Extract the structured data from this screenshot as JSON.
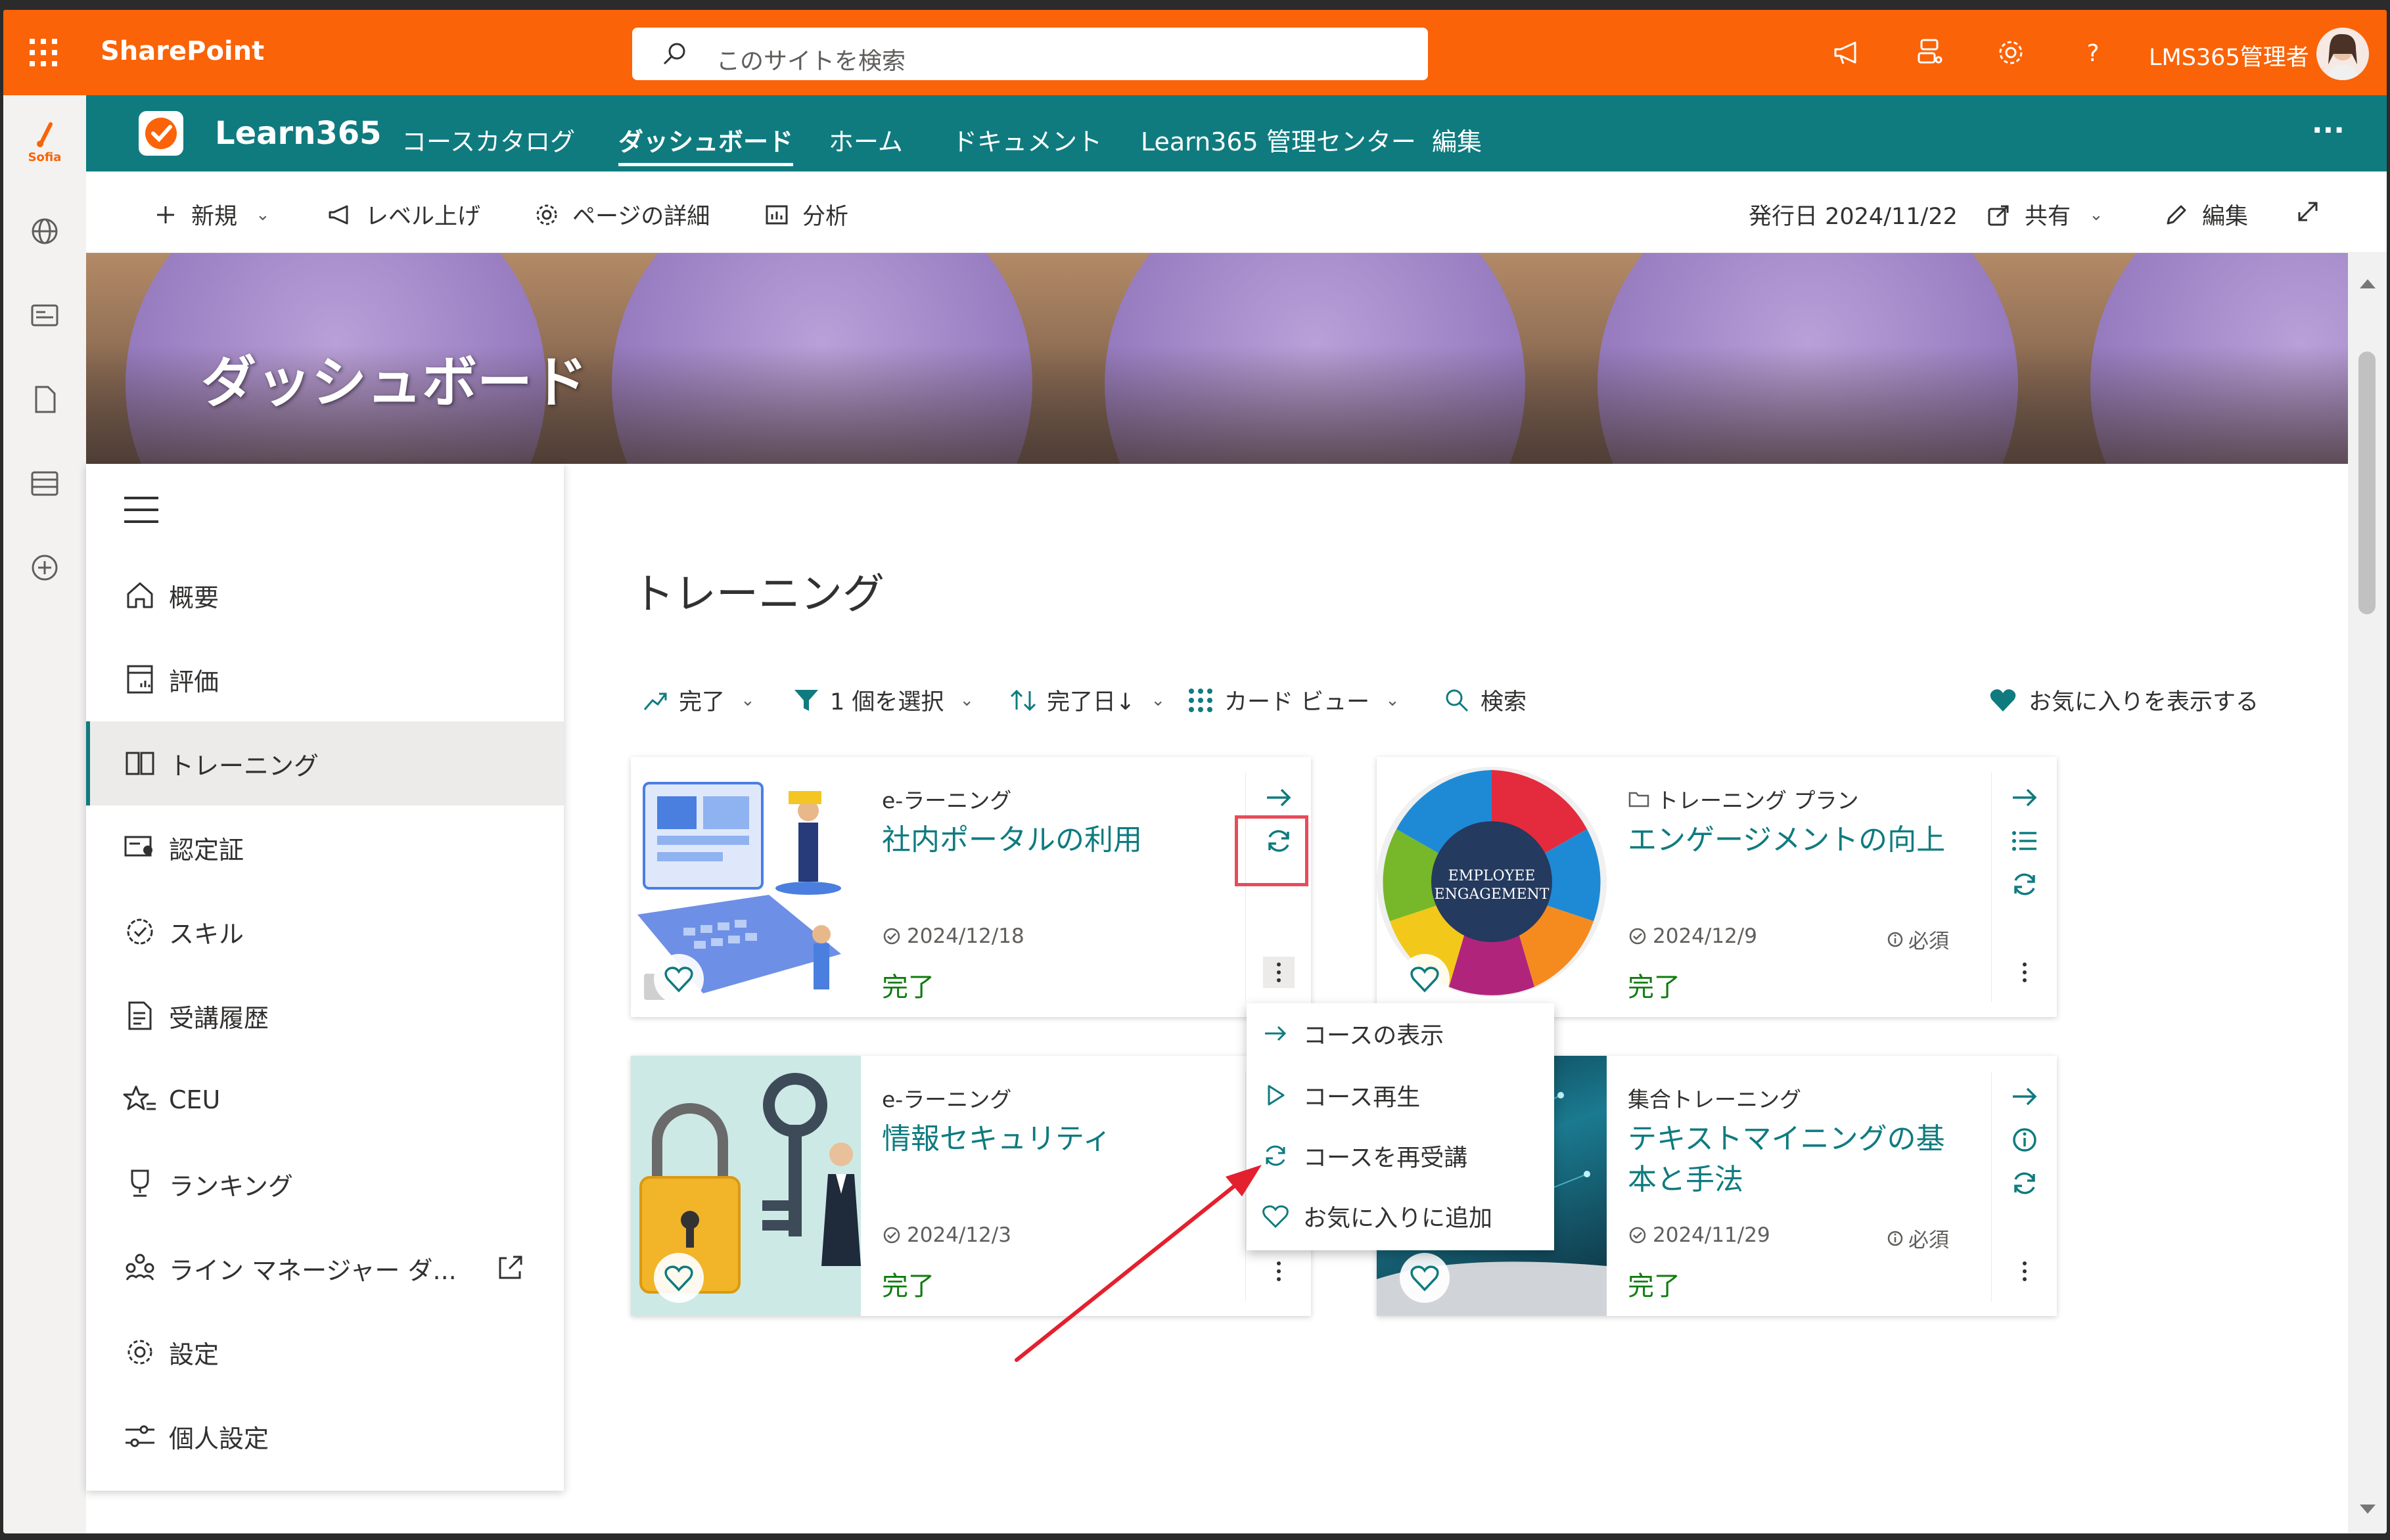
{
  "suite": {
    "brand": "SharePoint",
    "search_placeholder": "このサイトを検索",
    "user_name": "LMS365管理者"
  },
  "rail": {
    "logo_text": "Sofia"
  },
  "hub": {
    "title": "Learn365",
    "links": [
      "コースカタログ",
      "ダッシュボード",
      "ホーム",
      "ドキュメント",
      "Learn365 管理センター",
      "編集"
    ],
    "active_link": "ダッシュボード"
  },
  "command": {
    "new": "新規",
    "promote": "レベル上げ",
    "page_details": "ページの詳細",
    "analytics": "分析",
    "published": "発行日 2024/11/22",
    "share": "共有",
    "edit": "編集"
  },
  "hero": {
    "title": "ダッシュボード"
  },
  "nav": {
    "items": [
      {
        "label": "概要",
        "icon": "home-icon"
      },
      {
        "label": "評価",
        "icon": "assessment-icon"
      },
      {
        "label": "トレーニング",
        "icon": "book-icon"
      },
      {
        "label": "認定証",
        "icon": "certificate-icon"
      },
      {
        "label": "スキル",
        "icon": "skill-badge-icon"
      },
      {
        "label": "受講履歴",
        "icon": "history-doc-icon"
      },
      {
        "label": "CEU",
        "icon": "star-list-icon"
      },
      {
        "label": "ランキング",
        "icon": "trophy-icon"
      },
      {
        "label": "ライン マネージャー ダ...",
        "icon": "people-icon"
      },
      {
        "label": "設定",
        "icon": "gear-icon"
      },
      {
        "label": "個人設定",
        "icon": "sliders-icon"
      }
    ],
    "active": "トレーニング"
  },
  "main": {
    "title": "トレーニング",
    "filters": {
      "status": "完了",
      "filter": "1 個を選択",
      "sort": "完了日↓",
      "view": "カード ビュー",
      "search": "検索",
      "favorites": "お気に入りを表示する"
    }
  },
  "cards": [
    {
      "type": "e-ラーニング",
      "title": "社内ポータルの利用",
      "date": "2024/12/18",
      "required": "",
      "status": "完了"
    },
    {
      "type": "トレーニング プラン",
      "title": "エンゲージメントの向上",
      "date": "2024/12/9",
      "required": "必須",
      "status": "完了",
      "thumb_text": "EMPLOYEE ENGAGEMENT"
    },
    {
      "type": "e-ラーニング",
      "title": "情報セキュリティ",
      "date": "2024/12/3",
      "required": "",
      "status": "完了"
    },
    {
      "type": "集合トレーニング",
      "title": "テキストマイニングの基本と手法",
      "date": "2024/11/29",
      "required": "必須",
      "status": "完了"
    }
  ],
  "context_menu": {
    "items": [
      "コースの表示",
      "コース再生",
      "コースを再受講",
      "お気に入りに追加"
    ]
  },
  "colors": {
    "suite": "#fa6308",
    "hub": "#0f7b7f",
    "status_done": "#107c10",
    "annotation": "#e4202e"
  }
}
